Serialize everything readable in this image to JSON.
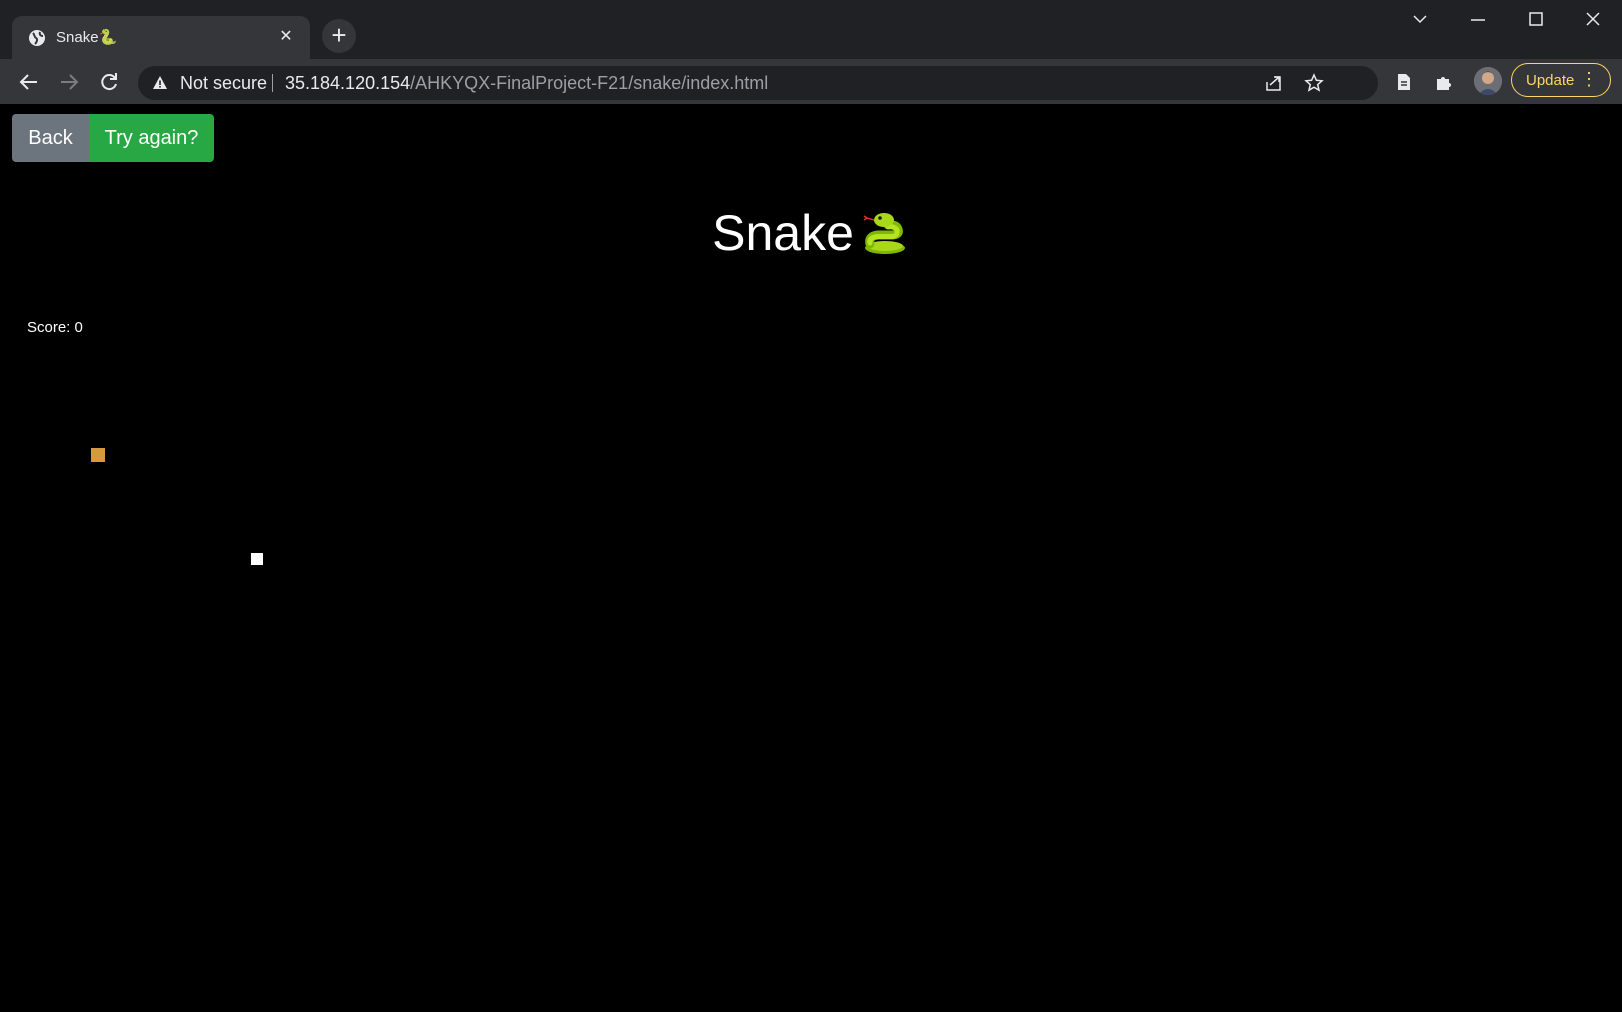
{
  "browser": {
    "tab": {
      "title": "Snake🐍",
      "favicon": "globe-icon"
    },
    "address": {
      "security": "Not secure",
      "host": "35.184.120.154",
      "path": "/AHKYQX-FinalProject-F21/snake/index.html"
    },
    "update_label": "Update",
    "colors": {
      "frame": "#202124",
      "toolbar": "#35363a",
      "update": "#fdd663"
    }
  },
  "page": {
    "buttons": {
      "back": "Back",
      "try_again": "Try again?"
    },
    "title": "Snake",
    "title_emoji": "snake-emoji",
    "score_label": "Score: 0",
    "colors": {
      "background": "#000000",
      "back_button": "#6c757d",
      "try_button": "#28a745",
      "food": "#d49a3c",
      "snake": "#ffffff"
    }
  }
}
